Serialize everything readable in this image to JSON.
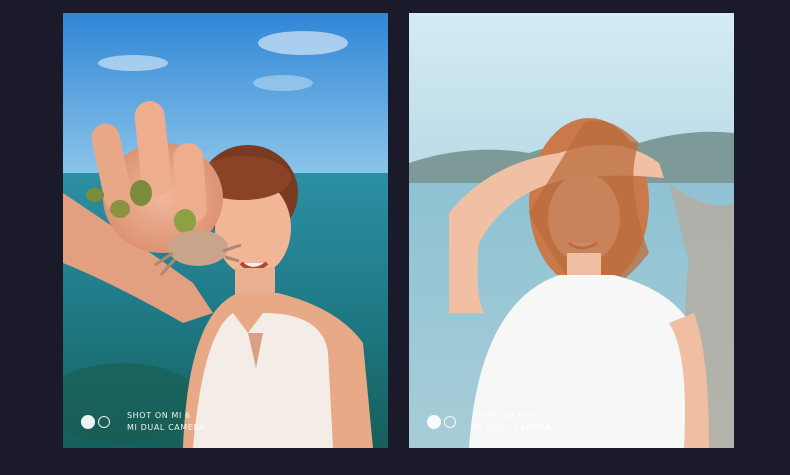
{
  "photos": [
    {
      "watermark": {
        "line1": "SHOT ON MI 6",
        "line2": "MI DUAL CAMERA"
      }
    },
    {
      "watermark": {
        "line1": "SHOT ON MI 6",
        "line2": "MI DUAL CAMERA"
      }
    }
  ],
  "colors": {
    "background": "#1b1a2a",
    "sky_left": "#3b8fd8",
    "sea_left": "#1f7a86",
    "sky_right": "#c9e4ef",
    "sea_right": "#9cc7d4",
    "nail_polish": "#7b8b3a"
  }
}
